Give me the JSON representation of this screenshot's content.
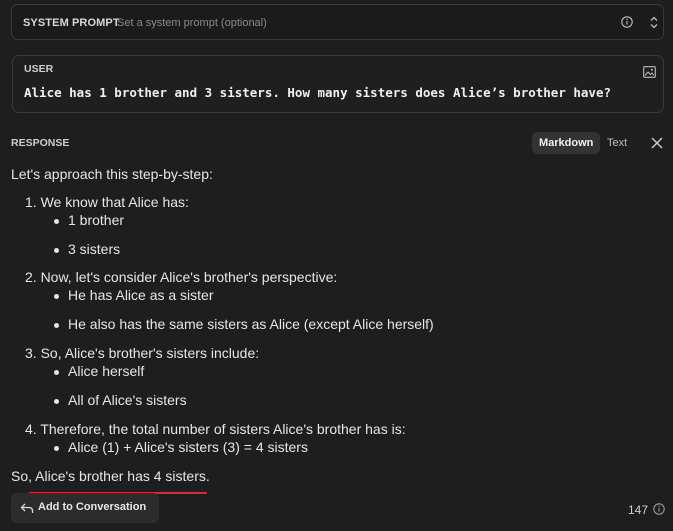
{
  "system_prompt": {
    "label": "SYSTEM PROMPT",
    "placeholder": "Set a system prompt (optional)",
    "icons": [
      "info-icon",
      "chevron-updown-icon"
    ]
  },
  "user": {
    "label": "USER",
    "message": "Alice has 1 brother and 3 sisters. How many sisters does Alice’s brother have?",
    "icons": [
      "image-icon"
    ]
  },
  "response": {
    "label": "RESPONSE",
    "tabs": [
      "Markdown",
      "Text"
    ],
    "active_tab": "Markdown",
    "lines": {
      "intro": "Let's approach this step-by-step:",
      "s1": "1. We know that Alice has:",
      "s1b1": "1 brother",
      "s1b2": "3 sisters",
      "s2": "2. Now, let's consider Alice's brother's perspective:",
      "s2b1": "He has Alice as a sister",
      "s2b2": "He also has the same sisters as Alice (except Alice herself)",
      "s3": "3. So, Alice's brother's sisters include:",
      "s3b1": "Alice herself",
      "s3b2": "All of Alice's sisters",
      "s4": "4. Therefore, the total number of sisters Alice's brother has is:",
      "s4b1": "Alice (1) + Alice's sisters (3) = 4 sisters",
      "conclusion": "So, Alice's brother has 4 sisters."
    }
  },
  "footer": {
    "add_button": "Add to Conversation",
    "token_count": "147"
  },
  "colors": {
    "background": "#1e1e1e",
    "underline": "#d0303a"
  }
}
